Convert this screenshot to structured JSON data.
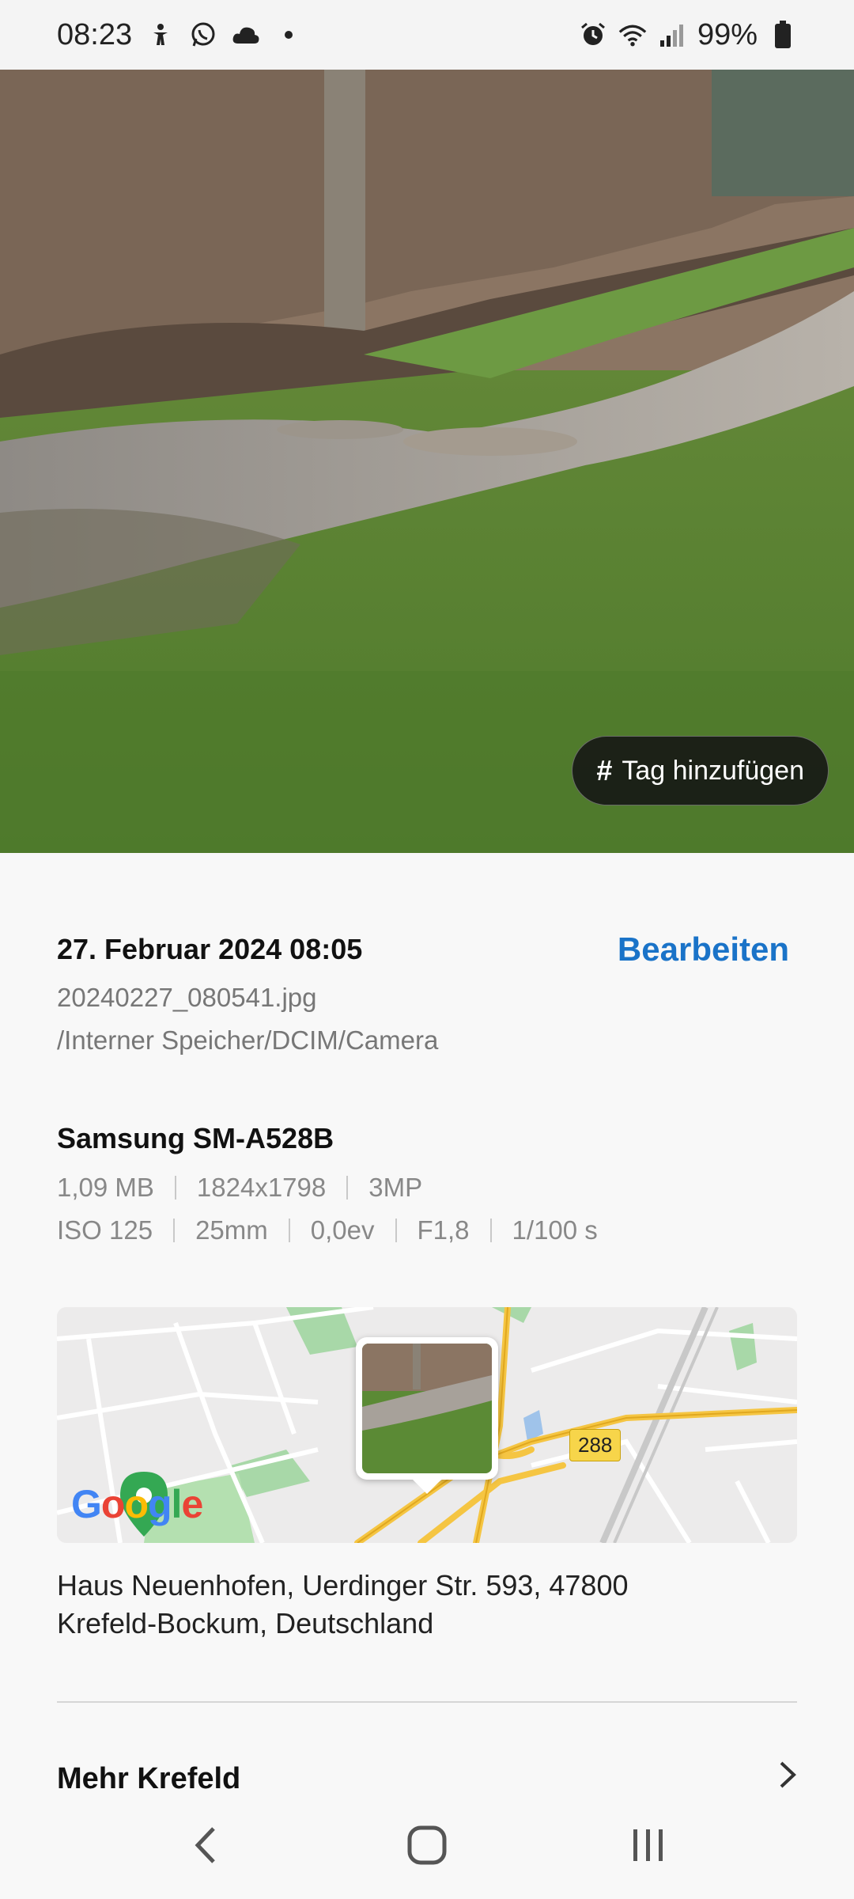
{
  "status_bar": {
    "time": "08:23",
    "battery": "99%",
    "left_icons": [
      "accessibility-icon",
      "whatsapp-icon",
      "cloud-icon",
      "dot-icon"
    ],
    "right_icons": [
      "alarm-icon",
      "wifi-icon",
      "signal-icon",
      "battery-icon"
    ]
  },
  "photo": {
    "tag_button_label": "Tag hinzufügen",
    "tag_button_icon": "#"
  },
  "details": {
    "date": "27. Februar 2024 08:05",
    "edit_label": "Bearbeiten",
    "filename": "20240227_080541.jpg",
    "path": "/Interner Speicher/DCIM/Camera",
    "device": "Samsung SM-A528B",
    "meta_line1": [
      "1,09 MB",
      "1824x1798",
      "3MP"
    ],
    "meta_line2": [
      "ISO 125",
      "25mm",
      "0,0ev",
      "F1,8",
      "1/100 s"
    ],
    "map": {
      "road_number": "288",
      "google_logo": "Google"
    },
    "address_line1": "Haus Neuenhofen, Uerdinger Str. 593, 47800",
    "address_line2": "Krefeld-Bockum, Deutschland",
    "more_label": "Mehr Krefeld"
  },
  "colors": {
    "accent": "#1a73c8",
    "background": "#f8f8f8",
    "muted_text": "#777777"
  }
}
